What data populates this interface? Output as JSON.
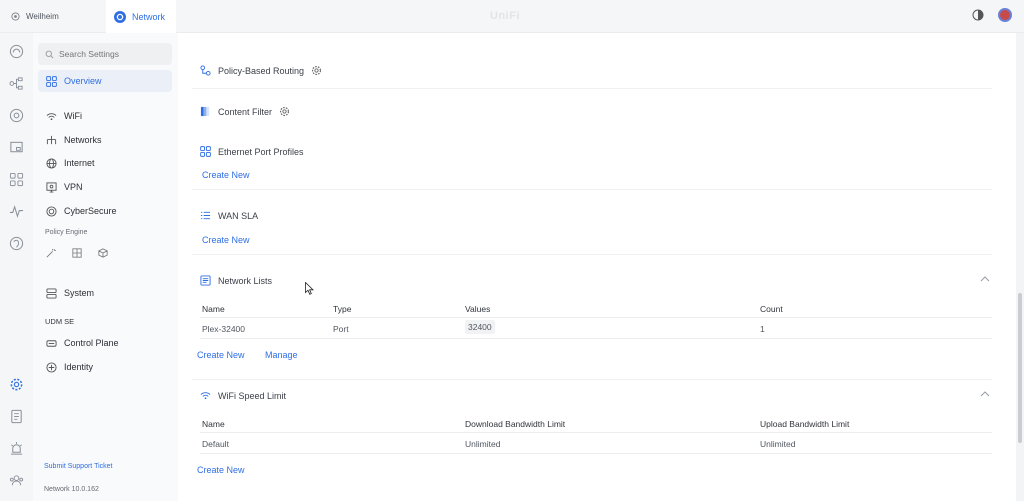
{
  "topbar": {
    "site_name": "Weilheim",
    "active_tab": "Network",
    "brand": "UniFi"
  },
  "search": {
    "placeholder": "Search Settings"
  },
  "nav": {
    "overview": "Overview",
    "wifi": "WiFi",
    "networks": "Networks",
    "internet": "Internet",
    "vpn": "VPN",
    "cybersecure": "CyberSecure",
    "policy_engine": "Policy Engine",
    "system": "System",
    "device_label": "UDM SE",
    "control_plane": "Control Plane",
    "identity": "Identity",
    "support": "Submit Support Ticket",
    "version": "Network 10.0.162"
  },
  "main": {
    "policy_routing": "Policy-Based Routing",
    "content_filter": "Content Filter",
    "ethernet_profiles": {
      "title": "Ethernet Port Profiles",
      "create": "Create New"
    },
    "wan_sla": {
      "title": "WAN SLA",
      "create": "Create New"
    },
    "network_lists": {
      "title": "Network Lists",
      "headers": {
        "name": "Name",
        "type": "Type",
        "values": "Values",
        "count": "Count"
      },
      "rows": [
        {
          "name": "Plex-32400",
          "type": "Port",
          "values": "32400",
          "count": "1"
        }
      ],
      "create": "Create New",
      "manage": "Manage"
    },
    "wifi_speed": {
      "title": "WiFi Speed Limit",
      "headers": {
        "name": "Name",
        "download": "Download Bandwidth Limit",
        "upload": "Upload Bandwidth Limit"
      },
      "rows": [
        {
          "name": "Default",
          "download": "Unlimited",
          "upload": "Unlimited"
        }
      ],
      "create": "Create New"
    }
  },
  "colors": {
    "accent": "#2f6fe4",
    "text": "#3a3f47"
  }
}
